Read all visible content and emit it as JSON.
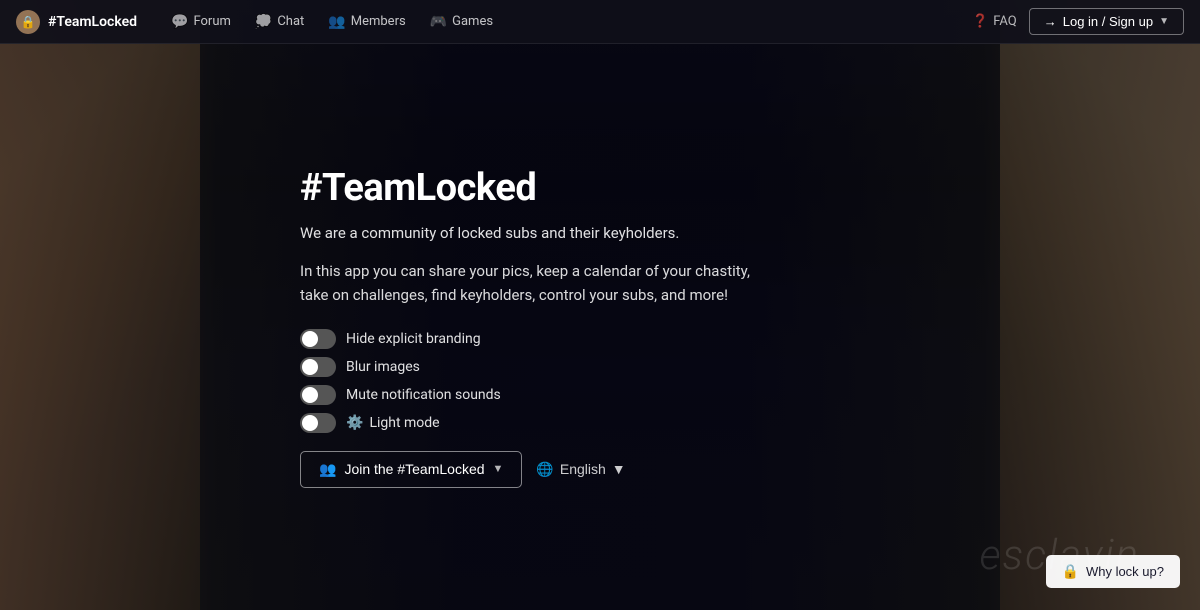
{
  "brand": {
    "logo_icon": "🔒",
    "name": "#TeamLocked"
  },
  "nav": {
    "links": [
      {
        "label": "Forum",
        "icon": "💬"
      },
      {
        "label": "Chat",
        "icon": "💭"
      },
      {
        "label": "Members",
        "icon": "👥"
      },
      {
        "label": "Games",
        "icon": "🎮"
      }
    ],
    "faq_label": "FAQ",
    "faq_icon": "❓",
    "login_label": "Log in / Sign up"
  },
  "hero": {
    "title": "#TeamLocked",
    "subtitle": "We are a community of locked subs and their keyholders.",
    "description": "In this app you can share your pics, keep a calendar of your chastity, take on challenges, find keyholders, control your subs, and more!",
    "toggles": [
      {
        "id": "branding",
        "label": "Hide explicit branding",
        "active": false,
        "icon": null
      },
      {
        "id": "blur",
        "label": "Blur images",
        "active": false,
        "icon": null
      },
      {
        "id": "mute",
        "label": "Mute notification sounds",
        "active": false,
        "icon": null
      },
      {
        "id": "lightmode",
        "label": "Light mode",
        "active": false,
        "icon": "⚙️"
      }
    ],
    "join_button": "Join the #TeamLocked",
    "join_icon": "👥",
    "language_label": "English",
    "language_icon": "🌐"
  },
  "watermark": {
    "text": "esclavin"
  },
  "why_button": {
    "label": "Why lock up?",
    "icon": "🔒"
  }
}
